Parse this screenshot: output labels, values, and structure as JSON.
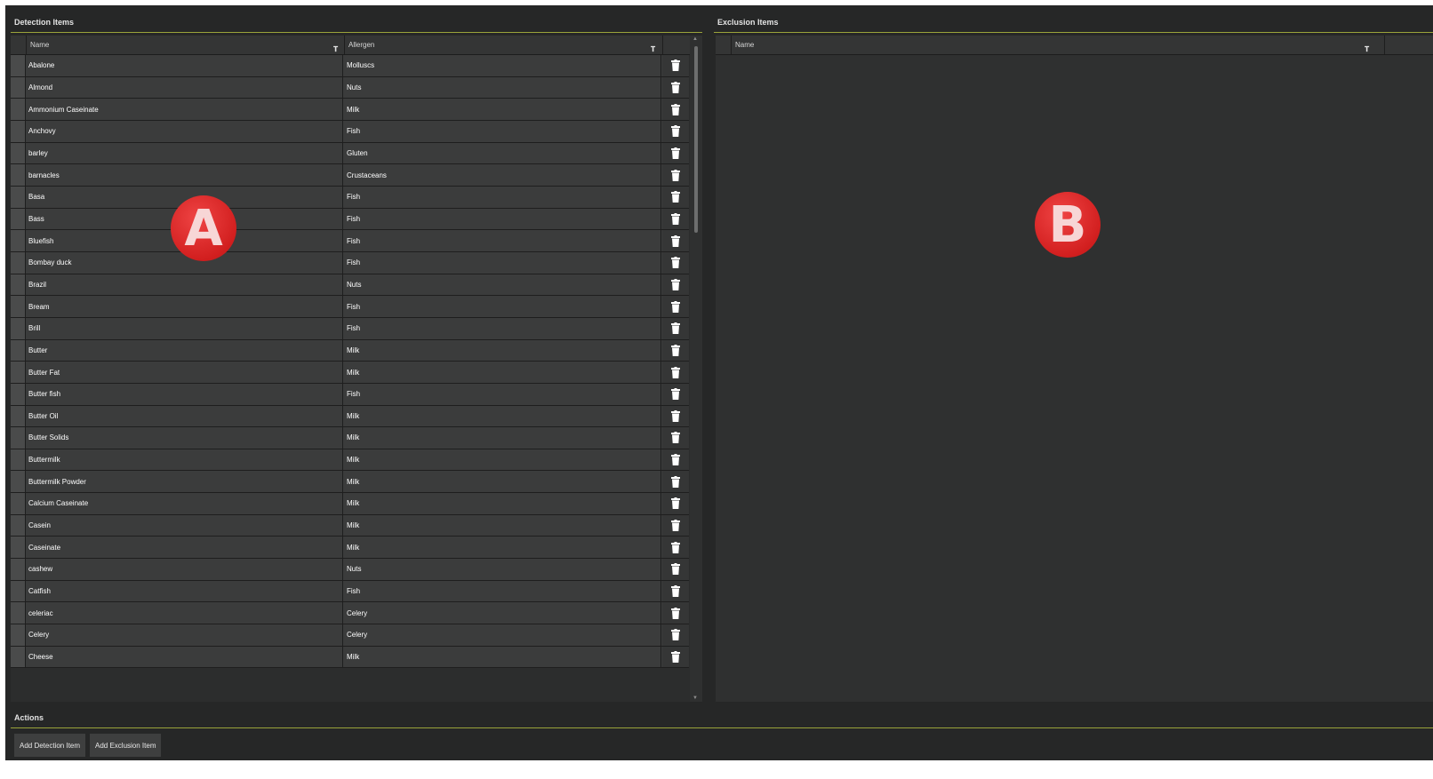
{
  "detection": {
    "title": "Detection Items",
    "columns": {
      "name": "Name",
      "allergen": "Allergen"
    },
    "rows": [
      {
        "name": "Abalone",
        "allergen": "Molluscs"
      },
      {
        "name": "Almond",
        "allergen": "Nuts"
      },
      {
        "name": "Ammonium Caseinate",
        "allergen": "Milk"
      },
      {
        "name": "Anchovy",
        "allergen": "Fish"
      },
      {
        "name": "barley",
        "allergen": "Gluten"
      },
      {
        "name": "barnacles",
        "allergen": "Crustaceans"
      },
      {
        "name": "Basa",
        "allergen": "Fish"
      },
      {
        "name": "Bass",
        "allergen": "Fish"
      },
      {
        "name": "Bluefish",
        "allergen": "Fish"
      },
      {
        "name": "Bombay duck",
        "allergen": "Fish"
      },
      {
        "name": "Brazil",
        "allergen": "Nuts"
      },
      {
        "name": "Bream",
        "allergen": "Fish"
      },
      {
        "name": "Brill",
        "allergen": "Fish"
      },
      {
        "name": "Butter",
        "allergen": "Milk"
      },
      {
        "name": "Butter Fat",
        "allergen": "Milk"
      },
      {
        "name": "Butter fish",
        "allergen": "Fish"
      },
      {
        "name": "Butter Oil",
        "allergen": "Milk"
      },
      {
        "name": "Butter Solids",
        "allergen": "Milk"
      },
      {
        "name": "Buttermilk",
        "allergen": "Milk"
      },
      {
        "name": "Buttermilk Powder",
        "allergen": "Milk"
      },
      {
        "name": "Calcium Caseinate",
        "allergen": "Milk"
      },
      {
        "name": "Casein",
        "allergen": "Milk"
      },
      {
        "name": "Caseinate",
        "allergen": "Milk"
      },
      {
        "name": "cashew",
        "allergen": "Nuts"
      },
      {
        "name": "Catfish",
        "allergen": "Fish"
      },
      {
        "name": "celeriac",
        "allergen": "Celery"
      },
      {
        "name": "Celery",
        "allergen": "Celery"
      },
      {
        "name": "Cheese",
        "allergen": "Milk"
      }
    ]
  },
  "exclusion": {
    "title": "Exclusion Items",
    "columns": {
      "name": "Name"
    }
  },
  "actions": {
    "title": "Actions",
    "add_detection": "Add Detection Item",
    "add_exclusion": "Add Exclusion Item"
  },
  "annotations": {
    "a": "A",
    "b": "B"
  },
  "colors": {
    "background": "#262727",
    "accent_rule": "#9aa33a",
    "badge": "#d21f1f"
  },
  "icons": {
    "filter": "filter-icon",
    "delete": "trash-icon"
  }
}
